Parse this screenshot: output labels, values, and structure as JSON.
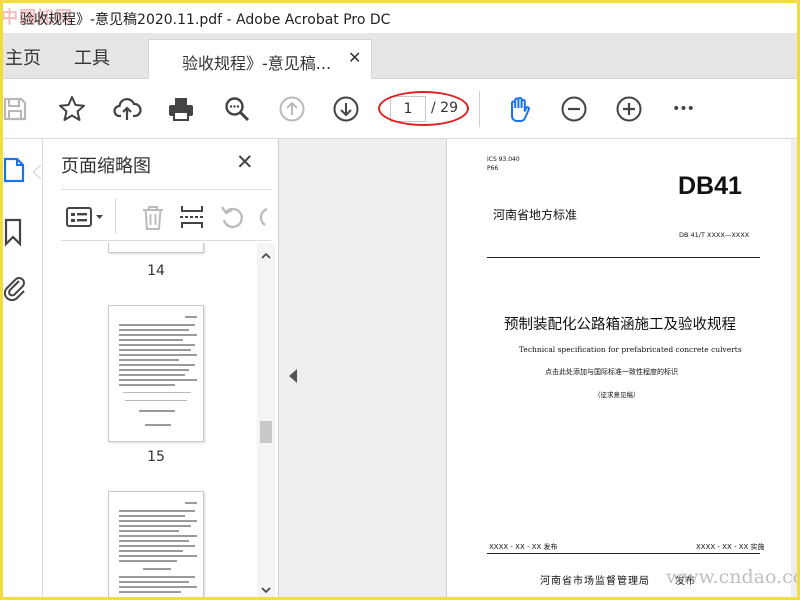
{
  "window": {
    "title": "验收规程》-意见稿2020.11.pdf - Adobe Acrobat Pro DC",
    "watermark_top": "中国知网"
  },
  "tabs": {
    "home": "主页",
    "tools": "工具",
    "document": "验收规程》-意见稿...",
    "close": "✕"
  },
  "toolbar": {
    "current_page": "1",
    "total_pages": "/ 29",
    "more": "•••"
  },
  "thumbnail_panel": {
    "title": "页面缩略图",
    "close": "✕",
    "pages": [
      "14",
      "15"
    ]
  },
  "document": {
    "ics": "ICS 93.040",
    "class_code": "P66",
    "standard_mark": "DB41",
    "standard_type": "河南省地方标准",
    "standard_number": "DB 41/T XXXX—XXXX",
    "title_cn": "预制装配化公路箱涵施工及验收规程",
    "title_en": "Technical specification for prefabricated concrete culverts",
    "consistency_note": "点击此处添加与国际标准一致性程度的标识",
    "draft_note": "（征求意见稿）",
    "issue_date": "XXXX - XX - XX 发布",
    "impl_date": "XXXX - XX - XX 实施",
    "issuer": "河南省市场监督管理局",
    "issue_word": "发布"
  },
  "watermark_bottom": "www.cndao.com",
  "colors": {
    "frame_border": "#f2dd3e",
    "accent_blue": "#1a73e8",
    "highlight_red": "#e02020"
  }
}
